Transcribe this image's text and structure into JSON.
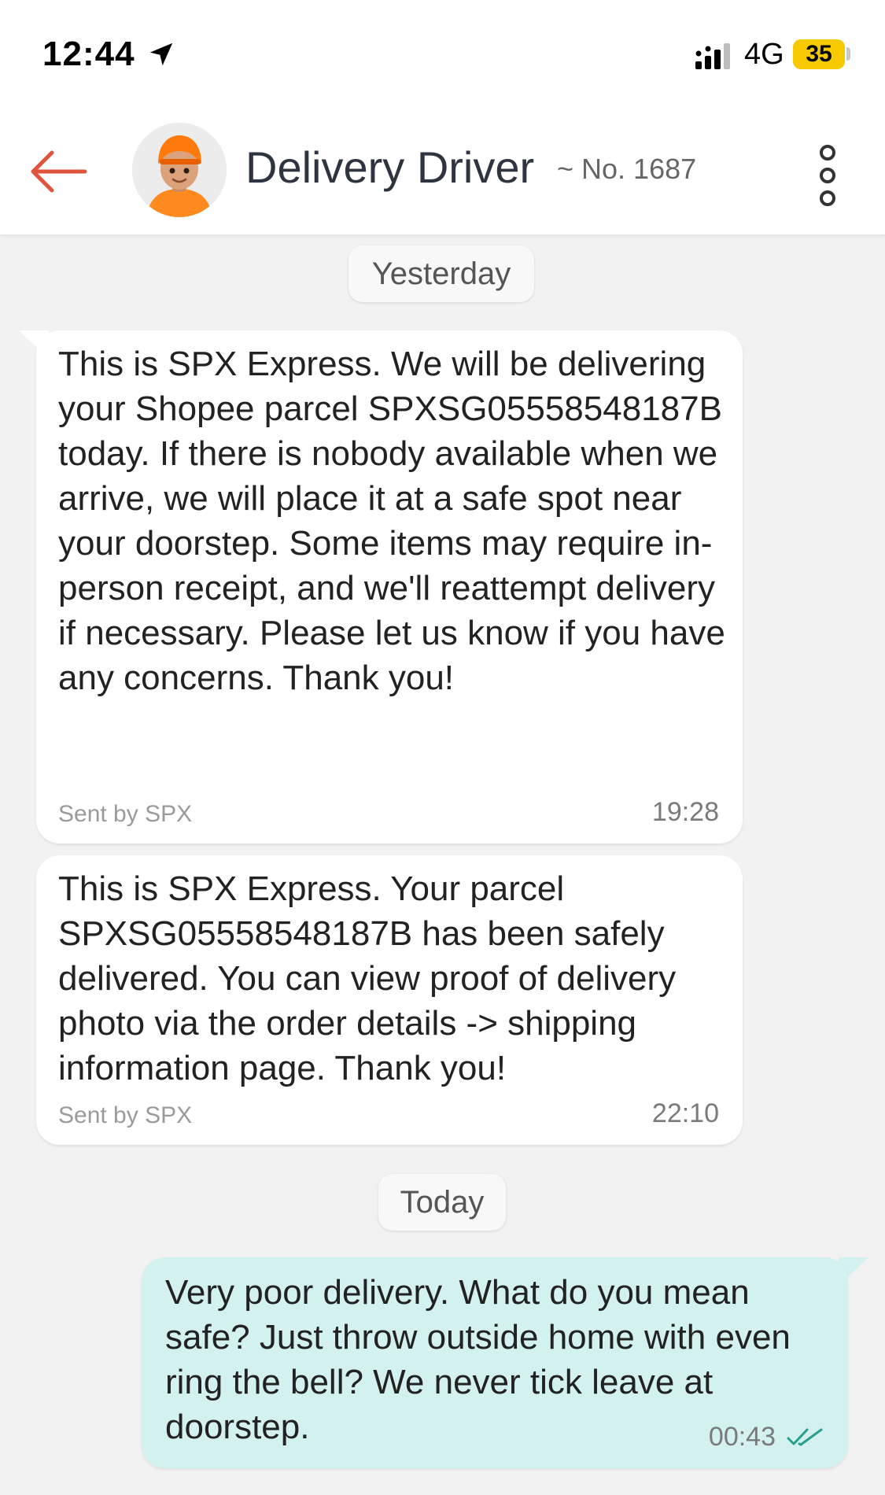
{
  "status_bar": {
    "time": "12:44",
    "network": "4G",
    "battery": "35",
    "icons": [
      "location-arrow-icon",
      "signal-icon",
      "battery-icon"
    ]
  },
  "header": {
    "title": "Delivery Driver",
    "subtitle": "~ No. 1687",
    "icons": [
      "back-arrow-icon",
      "driver-avatar",
      "more-options-icon"
    ],
    "accent": "#e0533d"
  },
  "chat": {
    "date_yesterday": "Yesterday",
    "date_today": "Today",
    "messages": [
      {
        "direction": "in",
        "text": "This is SPX Express. We will be delivering your Shopee parcel SPXSG05558548187B  today. If there is nobody available when we arrive, we will place it at a safe spot near your doorstep. Some items may require in-person receipt, and we'll reattempt delivery if necessary. Please let us know if you have any concerns. Thank you!",
        "sent_by": "Sent by SPX",
        "time": "19:28"
      },
      {
        "direction": "in",
        "text": "This is SPX Express. Your parcel SPXSG05558548187B  has been safely delivered. You can view proof of delivery photo via the order details -> shipping information page. Thank you!",
        "sent_by": "Sent by SPX",
        "time": "22:10"
      },
      {
        "direction": "out",
        "text": "Very poor delivery. What do you mean safe? Just throw outside home with even ring the bell? We never tick leave at doorstep.",
        "time": "00:43",
        "status_icon": "read-double-check-icon",
        "bubble_color": "#d3f1ee"
      }
    ]
  }
}
